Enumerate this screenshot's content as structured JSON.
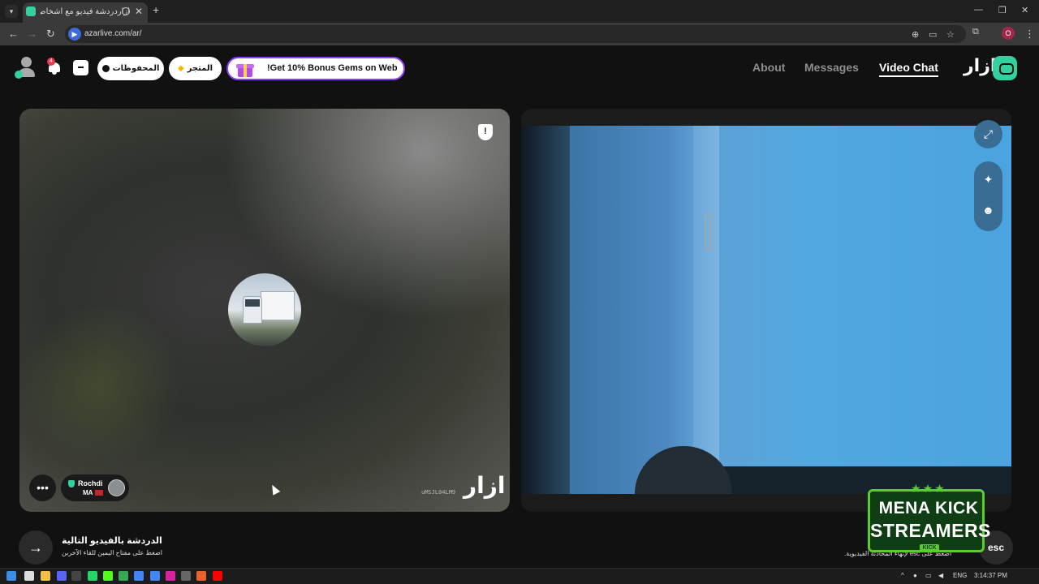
{
  "browser": {
    "tab_title": "أزاردردشة فيديو مع أشخاص",
    "url": "azarlive.com/ar/",
    "profile_initial": "O",
    "close_glyph": "✕",
    "new_tab_glyph": "+"
  },
  "header": {
    "notification_count": "4",
    "saved_label": "المحفوظات",
    "shop_label": "المتجر",
    "promo_text": "!Get 10% Bonus Gems on Web",
    "nav": {
      "about": "About",
      "messages": "Messages",
      "video_chat": "Video Chat"
    },
    "logo_text": "ازار"
  },
  "partner": {
    "name": "Rochdi",
    "country": "MA",
    "session_id": "uMSJL04LM9",
    "watermark": "ازار"
  },
  "footer": {
    "next_title": "الدردشة بالفيديو التالية",
    "next_hint": "اضغط على مفتاح اليمين للقاء الآخرين",
    "end_hint": "اضغط على esc لإنهاء المحادثة الفيديوية.",
    "esc_label": "esc"
  },
  "overlay": {
    "stars": "★★★",
    "line1": "MENA KICK",
    "line2": "STREAMERS",
    "tag": "KICK"
  },
  "taskbar": {
    "language": "ENG",
    "time": "3:14:37 PM"
  },
  "colors": {
    "brand": "#35d0a0",
    "promo_border": "#8a3ffc",
    "notification": "#e53b4a",
    "kick_green": "#5ccc2d"
  }
}
